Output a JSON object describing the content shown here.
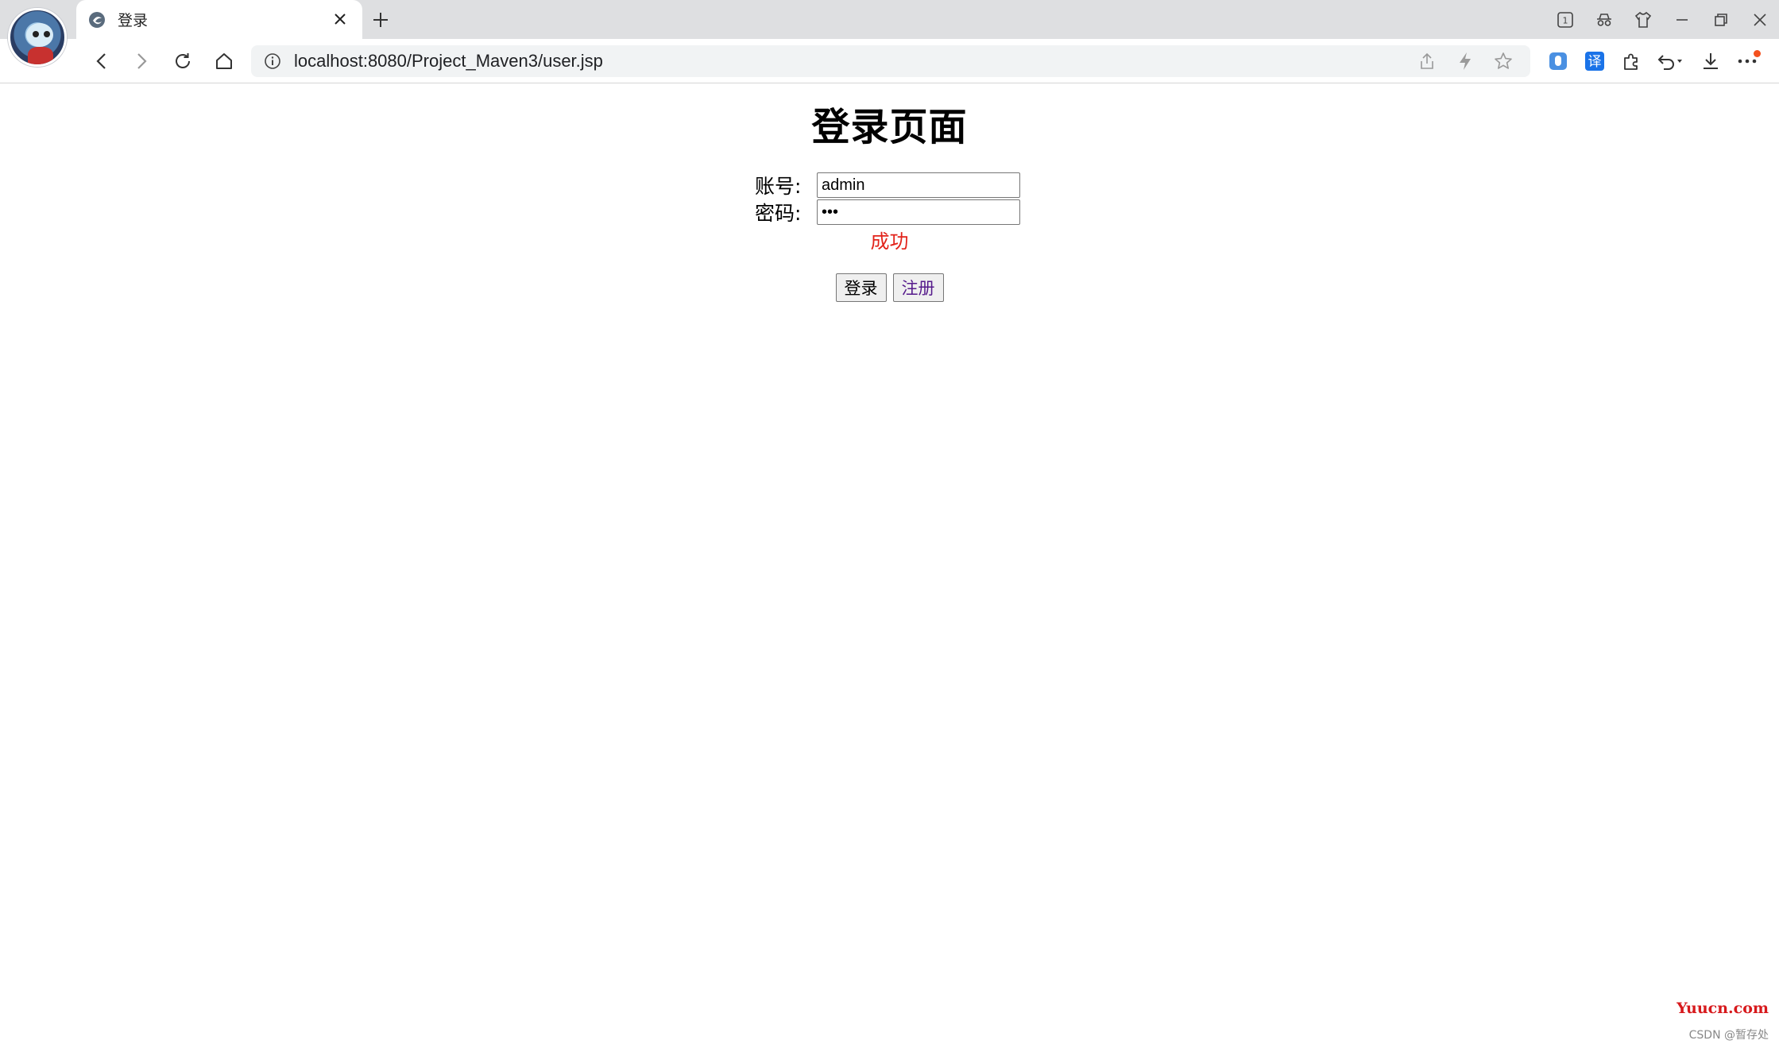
{
  "browser": {
    "tab": {
      "title": "登录"
    },
    "address_bar": {
      "url": "localhost:8080/Project_Maven3/user.jsp"
    },
    "icons": {
      "tab_favicon": "browser-logo-icon",
      "tab_close": "close-icon",
      "new_tab": "plus-icon",
      "back": "arrow-left-icon",
      "forward": "arrow-right-icon",
      "reload": "reload-icon",
      "home": "home-icon",
      "site_info": "info-icon",
      "share": "share-icon",
      "lightning": "lightning-icon",
      "favorite": "star-icon",
      "extension_blue": "extension-shield-icon",
      "translate": "translate-icon",
      "extensions": "puzzle-icon",
      "undo": "undo-icon",
      "download": "download-icon",
      "menu": "more-icon"
    },
    "translate_glyph": "译",
    "tab_count": "1"
  },
  "page": {
    "heading": "登录页面",
    "form": {
      "username_label": "账号:",
      "username_value": "admin",
      "password_label": "密码:",
      "password_value": "•••"
    },
    "status_message": "成功",
    "status_color": "#e2231a",
    "buttons": {
      "login": "登录",
      "register": "注册"
    }
  },
  "watermarks": {
    "site": "Yuucn.com",
    "csdn": "CSDN @暂存处"
  }
}
